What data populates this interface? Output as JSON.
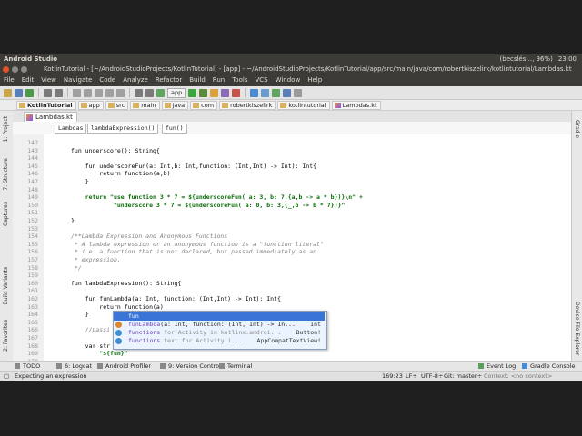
{
  "os": {
    "app_name": "Android Studio",
    "indicators": "(becslés..., 96%)",
    "clock": "23:00"
  },
  "window": {
    "title": "KotlinTutorial - [~/AndroidStudioProjects/KotlinTutorial] - [app] - ~/AndroidStudioProjects/KotlinTutorial/app/src/main/java/com/robertkiszelirk/kotlintutorial/Lambdas.kt"
  },
  "menu": [
    "File",
    "Edit",
    "View",
    "Navigate",
    "Code",
    "Analyze",
    "Refactor",
    "Build",
    "Run",
    "Tools",
    "VCS",
    "Window",
    "Help"
  ],
  "toolbar": {
    "run_config": "app"
  },
  "breadcrumbs": [
    "KotlinTutorial",
    "app",
    "src",
    "main",
    "java",
    "com",
    "robertkiszelirk",
    "kotlintutorial",
    "Lambdas.kt"
  ],
  "editor": {
    "tab": "Lambdas.kt",
    "structure": [
      "Lambdas",
      "lambdaExpression()",
      "fun()"
    ],
    "lines": [
      {
        "n": "142",
        "t": ""
      },
      {
        "n": "143",
        "t": "fun underscore(): String{"
      },
      {
        "n": "144",
        "t": ""
      },
      {
        "n": "145",
        "t": "    fun underscoreFun(a: Int,b: Int,function: (Int,Int) -> Int): Int{"
      },
      {
        "n": "146",
        "t": "        return function(a,b)"
      },
      {
        "n": "147",
        "t": "    }"
      },
      {
        "n": "148",
        "t": ""
      },
      {
        "n": "149",
        "t": "    return \"use function 3 * 7 = ${underscoreFun( a: 3, b: 7,{a,b -> a * b})}\\n\" +"
      },
      {
        "n": "150",
        "t": "            \"underscore 3 * 7 = ${underscoreFun( a: 0, b: 3,{_,b -> b * 7})}\""
      },
      {
        "n": "151",
        "t": ""
      },
      {
        "n": "152",
        "t": "}"
      },
      {
        "n": "153",
        "t": ""
      },
      {
        "n": "154",
        "t": "/**Lambda Expression and Anonymous Functions"
      },
      {
        "n": "155",
        "t": " * A lambda expression or an anonymous function is a \"function literal\""
      },
      {
        "n": "156",
        "t": " * i.e. a function that is not declared, but passed immediately as an"
      },
      {
        "n": "157",
        "t": " * expression."
      },
      {
        "n": "158",
        "t": " */"
      },
      {
        "n": "159",
        "t": ""
      },
      {
        "n": "160",
        "t": "fun lambdaExpression(): String{"
      },
      {
        "n": "161",
        "t": ""
      },
      {
        "n": "162",
        "t": "    fun funLambda(a: Int, function: (Int,Int) -> Int): Int{"
      },
      {
        "n": "163",
        "t": "        return function(a)"
      },
      {
        "n": "164",
        "t": "    }"
      },
      {
        "n": "165",
        "t": ""
      },
      {
        "n": "166",
        "t": "    //passi"
      },
      {
        "n": "167",
        "t": ""
      },
      {
        "n": "168",
        "t": "    var str"
      },
      {
        "n": "169",
        "t": "        \"${fun}\""
      },
      {
        "n": "170",
        "t": ""
      }
    ]
  },
  "autocomplete": [
    {
      "name": "fun",
      "type": "",
      "tail": "",
      "color": "#ffffff"
    },
    {
      "name": "funLambda",
      "tail": "(a: Int, function: (Int, Int) -> In...",
      "type": "Int",
      "color": "#e0862f"
    },
    {
      "name": "functions",
      "tail": "for Activity in kotlinx.androi...",
      "type": "Button!",
      "color": "#3f8fd4"
    },
    {
      "name": "functions",
      "tail": "text for Activity i...",
      "type": "AppCompatTextView!",
      "color": "#3f8fd4"
    }
  ],
  "bottom_tabs": [
    "TODO",
    "6: Logcat",
    "Android Profiler",
    "9: Version Control",
    "Terminal",
    "Event Log",
    "Gradle Console"
  ],
  "status": {
    "message": "Expecting an expression",
    "position": "169:23",
    "line_sep": "LF÷",
    "encoding": "UTF-8÷",
    "git": "Git: master÷",
    "context": "Context: <no context>"
  },
  "left_tools": [
    "1: Project",
    "7: Structure",
    "Captures",
    "Build Variants",
    "2: Favorites"
  ],
  "right_tools": [
    "Gradle",
    "Device File Explorer"
  ]
}
